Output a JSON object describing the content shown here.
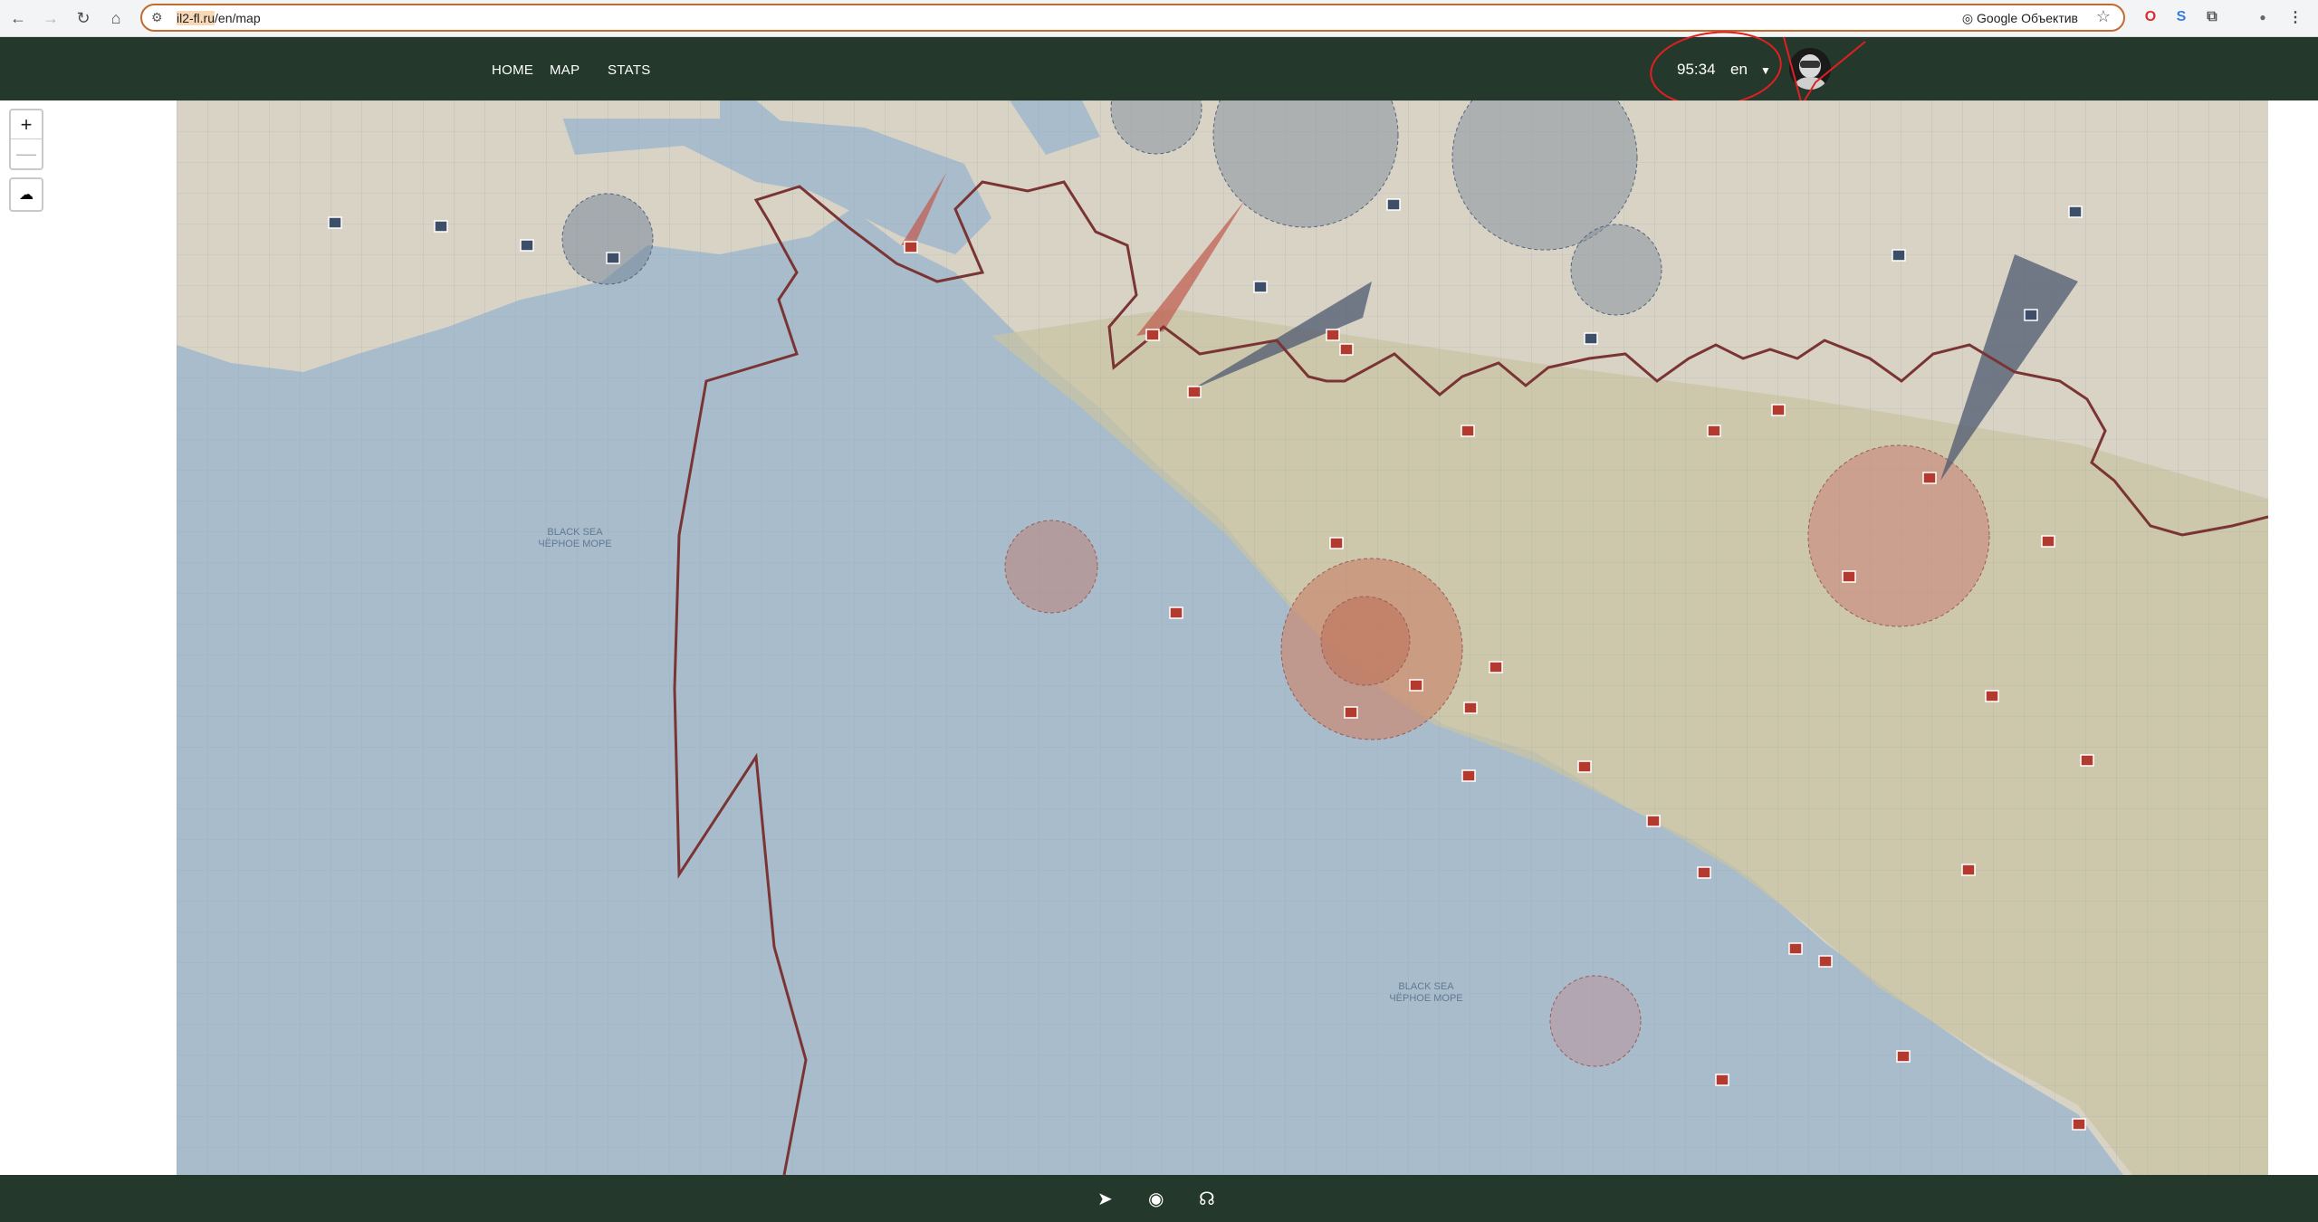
{
  "browser": {
    "url_selected": "il2-fl.ru",
    "url_rest": "/en/map",
    "lens_label": "Google Объектив"
  },
  "header": {
    "menu": [
      {
        "label": "HOME"
      },
      {
        "label": "MAP"
      },
      {
        "label": "STATS"
      }
    ],
    "timer": "95:34",
    "language": "en"
  },
  "map": {
    "sea_label_en": "BLACK SEA",
    "sea_label_ru": "ЧЁРНОЕ МОРЕ",
    "zoom_in_label": "+",
    "zoom_out_label": "—"
  },
  "colors": {
    "header_bg": "#24392b",
    "sea": "#a9bccb",
    "land": "#d7d1c2",
    "front_line": "#7a3434",
    "red_marker": "#b23a2e",
    "blue_marker": "#4a5b73"
  },
  "icons": {
    "telegram": "telegram-icon",
    "discord": "discord-icon",
    "support": "headset-icon"
  }
}
